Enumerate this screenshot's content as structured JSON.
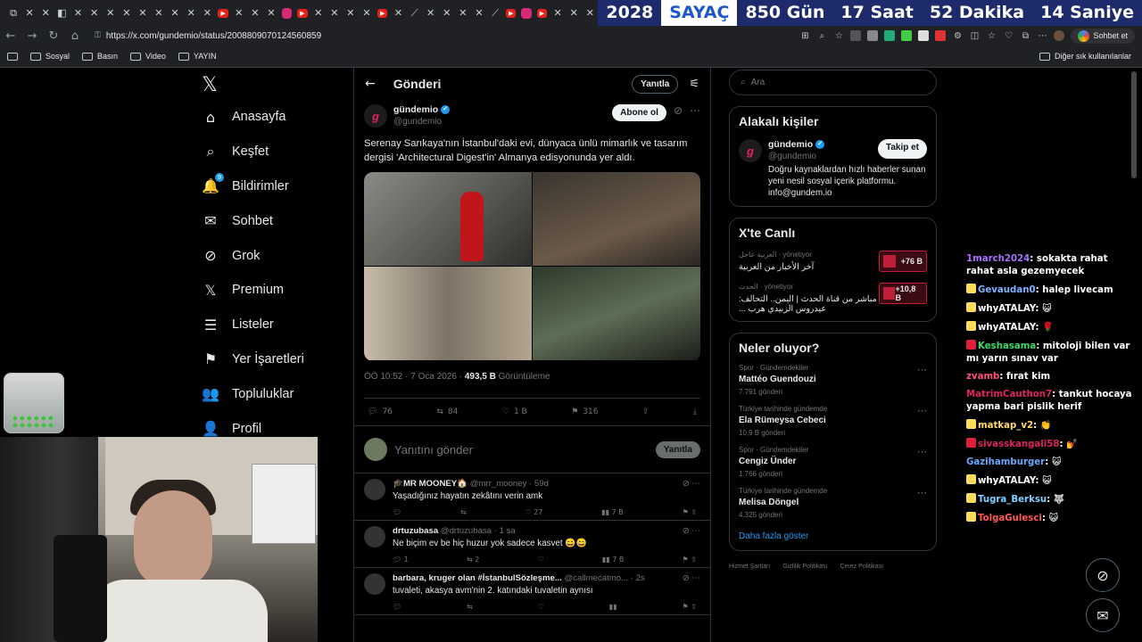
{
  "counter": {
    "year": "2028",
    "label": "SAYAÇ",
    "days": "850 Gün",
    "hours": "17 Saat",
    "minutes": "52 Dakika",
    "seconds": "14 Saniye"
  },
  "browser": {
    "url": "https://x.com/gundemio/status/2008809070124560859",
    "chat_button": "Sohbet et",
    "bookmarks": [
      "Sosyal",
      "Basın",
      "Video",
      "YAYIN"
    ],
    "bookmarks_right": "Diğer sık kullanılanlar"
  },
  "nav": {
    "items": [
      {
        "label": "Anasayfa",
        "icon": "⌂"
      },
      {
        "label": "Keşfet",
        "icon": "⌕"
      },
      {
        "label": "Bildirimler",
        "icon": "🔔",
        "badge": "9"
      },
      {
        "label": "Sohbet",
        "icon": "✉"
      },
      {
        "label": "Grok",
        "icon": "⊘"
      },
      {
        "label": "Premium",
        "icon": "𝕏"
      },
      {
        "label": "Listeler",
        "icon": "☰"
      },
      {
        "label": "Yer İşaretleri",
        "icon": "⚑"
      },
      {
        "label": "Topluluklar",
        "icon": "👥"
      },
      {
        "label": "Profil",
        "icon": "👤"
      }
    ]
  },
  "post": {
    "header_title": "Gönderi",
    "header_reply": "Yanıtla",
    "author_name": "gündemio",
    "author_handle": "@gundemio",
    "follow_label": "Abone ol",
    "text": "Serenay Sarıkaya'nın İstanbul'daki evi, dünyaca ünlü mimarlık ve tasarım dergisi 'Architectural Digest'in' Almanya edisyonunda yer aldı.",
    "time": "ÖÖ 10:52 · 7 Oca 2026 · ",
    "views": "493,5 B",
    "views_label": " Görüntüleme",
    "replies": "76",
    "reposts": "84",
    "likes": "1 B",
    "bookmarks": "316",
    "reply_placeholder": "Yanıtını gönder",
    "reply_button": "Yanıtla"
  },
  "replies": [
    {
      "name": "🎓MR MOONEY🏠",
      "handle": "@mrr_mooney · 59d",
      "text": "Yaşadığınız hayatın zekâtını verin amk",
      "c1": "",
      "c2": "",
      "c3": "27",
      "c4": "7 B"
    },
    {
      "name": "drtuzubasa",
      "handle": "@drtuzubasa · 1 sa",
      "text": "Ne biçim ev be hiç huzur yok sadece kasvet 😄😄",
      "c1": "1",
      "c2": "2",
      "c3": "",
      "c4": "7 B"
    },
    {
      "name": "barbara, kruger olan #İstanbulSözleşme...",
      "handle": "@callmecatmo... · 2s",
      "text": "tuvaleti, akasya avm'nin 2. katındaki tuvaletin aynısı",
      "c1": "",
      "c2": "",
      "c3": "",
      "c4": ""
    }
  ],
  "right": {
    "search_placeholder": "Ara",
    "related_title": "Alakalı kişiler",
    "rp_name": "gündemio",
    "rp_handle": "@gundemio",
    "rp_follow": "Takip et",
    "rp_bio": "Doğru kaynaklardan hızlı haberler sunan yeni nesil sosyal içerik platformu. info@gundem.io",
    "live_title": "X'te Canlı",
    "live": [
      {
        "src": "العربية عاجل",
        "role": "yönetiyor",
        "text": "آخر الأخبار من العربية",
        "count": "+76 B"
      },
      {
        "src": "الحدث",
        "role": "yönetiyor",
        "text": "مباشر من قناة الحدث | اليمن.. التحالف: عيدروس الزبيدي هرب ...",
        "count": "+10,8 B"
      }
    ],
    "trends_title": "Neler oluyor?",
    "trends": [
      {
        "cat": "Spor · Gündemdekiler",
        "name": "Mattéo Guendouzi",
        "count": "7.791 gönderi"
      },
      {
        "cat": "Türkiye tarihinde gündemde",
        "name": "Ela Rümeysa Cebeci",
        "count": "10,9 B gönderi"
      },
      {
        "cat": "Spor · Gündemdekiler",
        "name": "Cengiz Ünder",
        "count": "1.766 gönderi"
      },
      {
        "cat": "Türkiye tarihinde gündemde",
        "name": "Melisa Döngel",
        "count": "4.325 gönderi"
      }
    ],
    "more": "Daha fazla göster",
    "footer": [
      "Hizmet Şartları",
      "Gizlilik Politikası",
      "Çerez Politikası"
    ]
  },
  "chat": [
    {
      "user": "1march2024",
      "color": "#a970ff",
      "text": "sokakta rahat rahat asla gezemyecek",
      "badge": ""
    },
    {
      "user": "Gevaudan0",
      "color": "#7fb2ff",
      "text": "halep livecam",
      "badge": "y"
    },
    {
      "user": "whyATALAY",
      "color": "#ffffff",
      "text": "😺",
      "badge": "y"
    },
    {
      "user": "whyATALAY",
      "color": "#ffffff",
      "text": "🌹",
      "badge": "y"
    },
    {
      "user": "Keshasama",
      "color": "#3fd76a",
      "text": "mitoloji bilen var mı yarın sınav var",
      "badge": "r"
    },
    {
      "user": "zvamb",
      "color": "#ff4f7b",
      "text": "fırat kim",
      "badge": ""
    },
    {
      "user": "MatrimCauthon7",
      "color": "#e0245e",
      "text": "tankut hocaya yapma bari pislik herif",
      "badge": ""
    },
    {
      "user": "matkap_v2",
      "color": "#ffd76a",
      "text": "👏",
      "badge": "y"
    },
    {
      "user": "sivasskangali58",
      "color": "#e0245e",
      "text": "💅",
      "badge": "r"
    },
    {
      "user": "Gazihamburger",
      "color": "#6aa8ff",
      "text": "😺",
      "badge": ""
    },
    {
      "user": "whyATALAY",
      "color": "#ffffff",
      "text": "😺",
      "badge": "y"
    },
    {
      "user": "Tugra_Berksu",
      "color": "#7fd0ff",
      "text": "🐺",
      "badge": "y"
    },
    {
      "user": "TolgaGulesci",
      "color": "#ff5a5a",
      "text": "😺",
      "badge": "y"
    }
  ]
}
